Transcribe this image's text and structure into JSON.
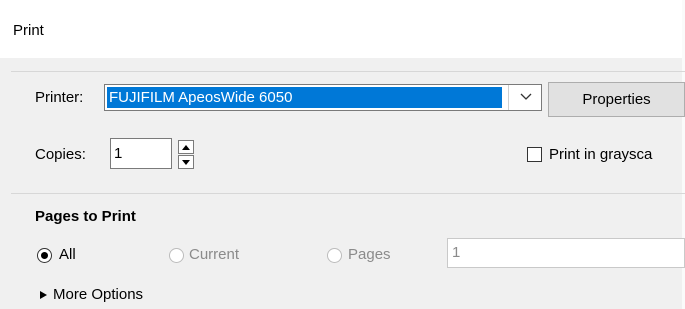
{
  "window": {
    "title": "Print"
  },
  "printer": {
    "label": "Printer:",
    "selected": "FUJIFILM ApeosWide 6050",
    "properties_button": "Properties"
  },
  "copies": {
    "label": "Copies:",
    "value": "1"
  },
  "grayscale": {
    "label": "Print in graysca",
    "checked": false
  },
  "pages_to_print": {
    "title": "Pages to Print",
    "options": [
      {
        "label": "All",
        "selected": true,
        "enabled": true
      },
      {
        "label": "Current",
        "selected": false,
        "enabled": false
      },
      {
        "label": "Pages",
        "selected": false,
        "enabled": false
      }
    ],
    "pages_value": "1",
    "more_options": "More Options"
  }
}
